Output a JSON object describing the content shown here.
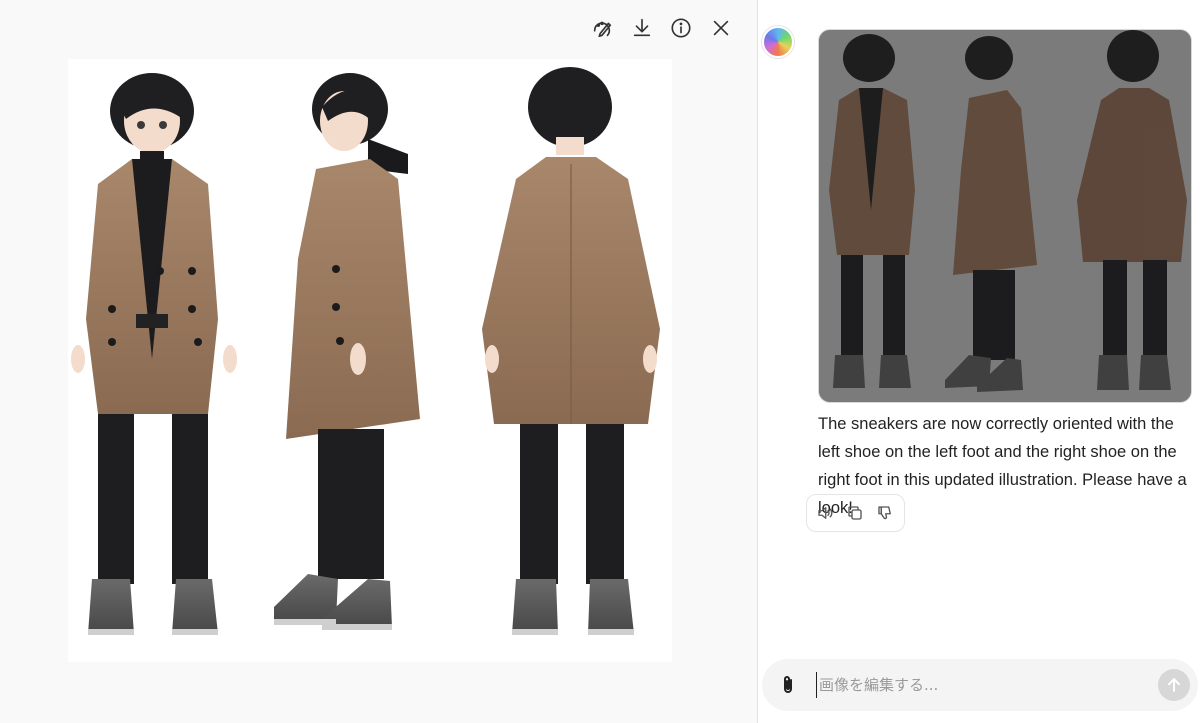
{
  "viewer": {
    "toolbar": {
      "edit_icon": "brush-edit-icon",
      "download_icon": "download-icon",
      "info_icon": "info-icon",
      "close_icon": "close-icon"
    },
    "image_description_icon": "character-sheet-image"
  },
  "chat": {
    "assistant_message": "The sneakers are now correctly oriented with the left shoe on the left foot and the right shoe on the right foot in this updated illustration. Please have a look!",
    "actions": [
      "speaker-icon",
      "copy-icon",
      "thumbs-down-icon"
    ],
    "composer": {
      "placeholder": "画像を編集する..."
    }
  },
  "colors": {
    "coat": "#9b7a5f",
    "hair": "#1f1f22",
    "pants": "#1e1e20",
    "shoe": "#5a5a5a"
  }
}
